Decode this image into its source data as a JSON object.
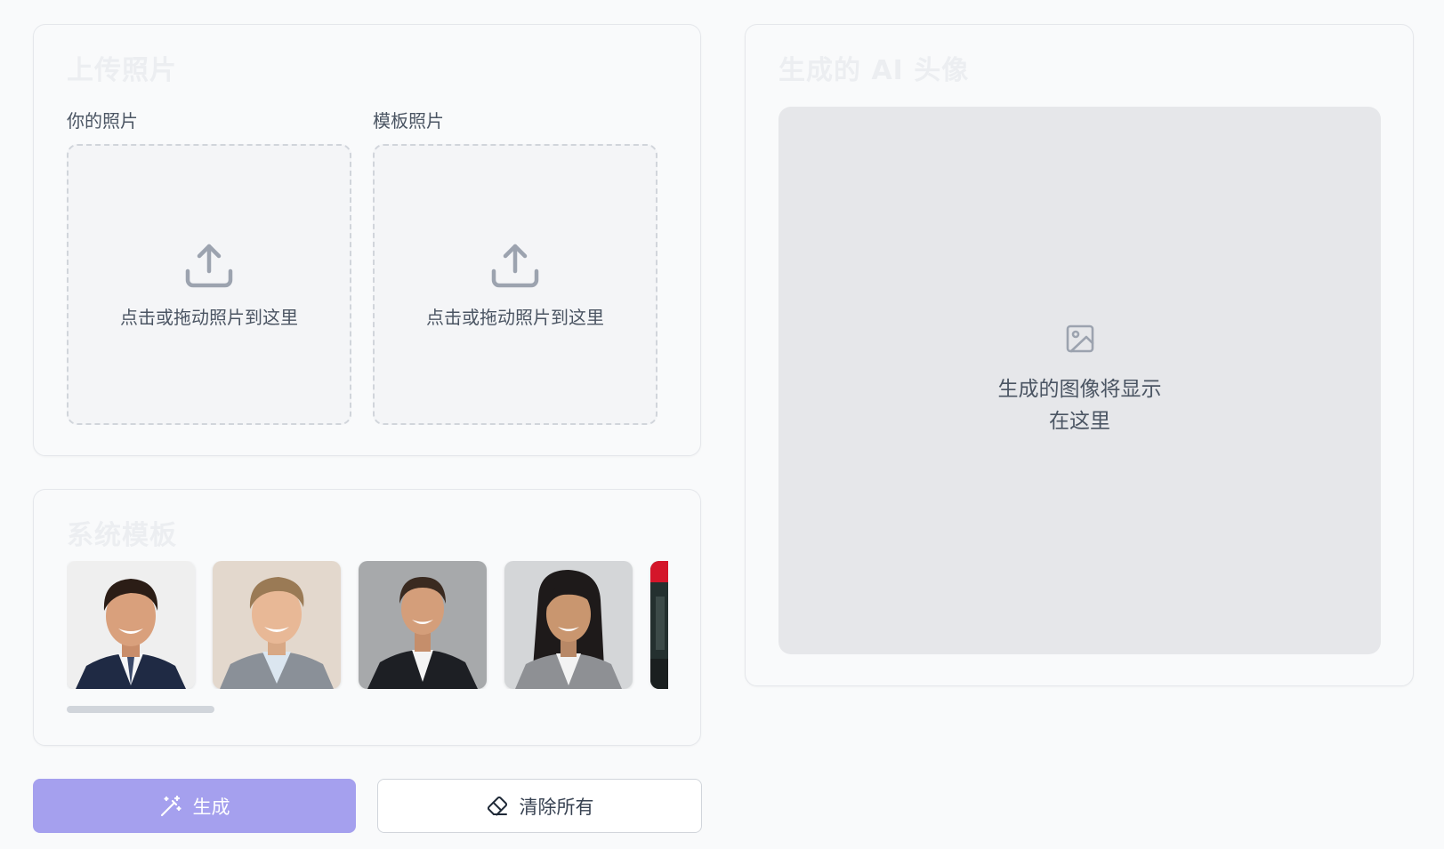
{
  "upload": {
    "title": "上传照片",
    "your_photo_label": "你的照片",
    "template_photo_label": "模板照片",
    "dropzone_text": "点击或拖动照片到这里"
  },
  "templates": {
    "title": "系统模板",
    "items": [
      {
        "icon": "template-man-smiling-navy-suit"
      },
      {
        "icon": "template-man-blond-grey-suit"
      },
      {
        "icon": "template-man-dark-suit-grey-backdrop"
      },
      {
        "icon": "template-woman-grey-blazer"
      },
      {
        "icon": "template-partial-red-thumbnail"
      }
    ]
  },
  "result": {
    "title": "生成的 AI 头像",
    "placeholder": "生成的图像将显示在这里"
  },
  "actions": {
    "generate_label": "生成",
    "clear_label": "清除所有"
  },
  "colors": {
    "accent": "#a5a0ee",
    "background": "#f9fafb",
    "result_area": "#e6e7ea"
  }
}
